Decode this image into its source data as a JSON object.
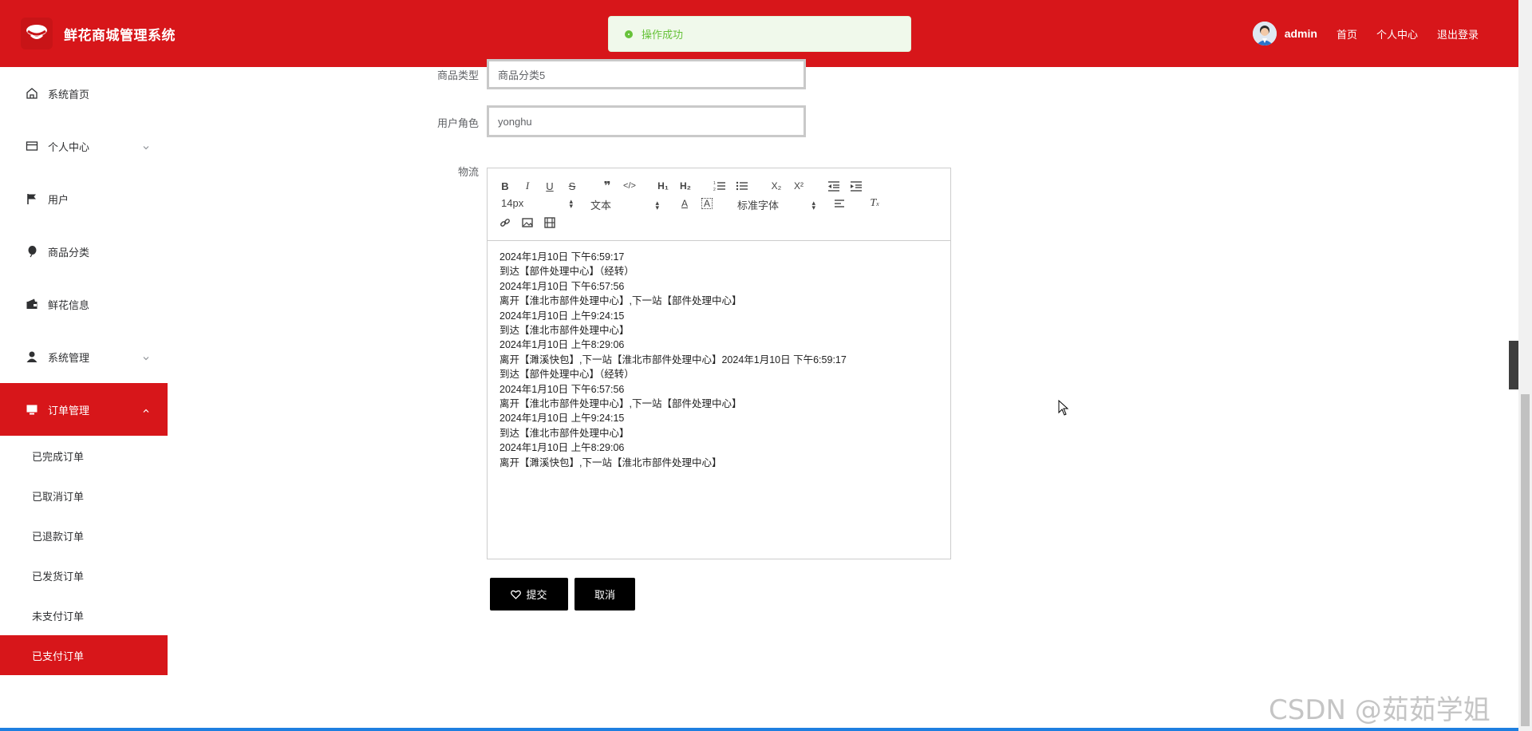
{
  "header": {
    "app_title": "鲜花商城管理系统",
    "toast": "操作成功",
    "username": "admin",
    "links": [
      "首页",
      "个人中心",
      "退出登录"
    ]
  },
  "sidebar": {
    "items": [
      {
        "label": "系统首页",
        "icon": "home-icon"
      },
      {
        "label": "个人中心",
        "icon": "card-icon",
        "expandable": true
      },
      {
        "label": "用户",
        "icon": "flag-icon"
      },
      {
        "label": "商品分类",
        "icon": "balloon-icon"
      },
      {
        "label": "鲜花信息",
        "icon": "wallet-icon"
      },
      {
        "label": "系统管理",
        "icon": "user-icon",
        "expandable": true
      },
      {
        "label": "订单管理",
        "icon": "monitor-icon",
        "expandable": true,
        "active": true
      }
    ],
    "sub_items": [
      {
        "label": "已完成订单"
      },
      {
        "label": "已取消订单"
      },
      {
        "label": "已退款订单"
      },
      {
        "label": "已发货订单"
      },
      {
        "label": "未支付订单"
      },
      {
        "label": "已支付订单",
        "active": true
      }
    ]
  },
  "form": {
    "product_type_label": "商品类型",
    "product_type_value": "商品分类5",
    "user_role_label": "用户角色",
    "user_role_value": "yonghu",
    "logistics_label": "物流",
    "toolbar": {
      "font_size": "14px",
      "header_select": "文本",
      "font_family": "标准字体"
    },
    "logistics_lines": [
      "2024年1月10日 下午6:59:17",
      "到达【部件处理中心】（经转）",
      "2024年1月10日 下午6:57:56",
      "离开【淮北市部件处理中心】,下一站【部件处理中心】",
      "2024年1月10日 上午9:24:15",
      "到达【淮北市部件处理中心】",
      "2024年1月10日 上午8:29:06",
      "离开【濉溪快包】,下一站【淮北市部件处理中心】2024年1月10日 下午6:59:17",
      "到达【部件处理中心】（经转）",
      "2024年1月10日 下午6:57:56",
      "离开【淮北市部件处理中心】,下一站【部件处理中心】",
      "2024年1月10日 上午9:24:15",
      "到达【淮北市部件处理中心】",
      "2024年1月10日 上午8:29:06",
      "离开【濉溪快包】,下一站【淮北市部件处理中心】"
    ],
    "submit_label": "提交",
    "cancel_label": "取消"
  },
  "watermark": "CSDN @茹茹学姐",
  "colors": {
    "brand_red": "#d7161a",
    "toast_green": "#67c23a",
    "button_black": "#000000"
  }
}
